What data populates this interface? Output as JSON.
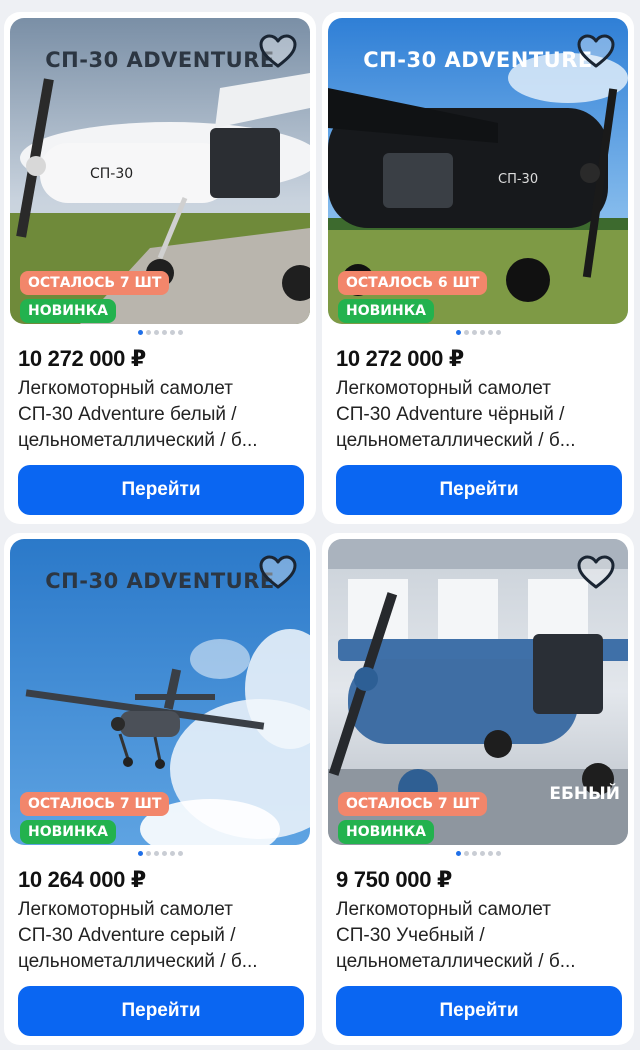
{
  "colors": {
    "accent": "#0a66f2",
    "stock_badge": "#f2866b",
    "new_badge": "#23b24e",
    "dot_active": "#1f6fe8"
  },
  "products": [
    {
      "photo_title": "СП-30 ADVENTURE",
      "photo_subtitle": "",
      "stock_badge": "ОСТАЛОСЬ 7 ШТ",
      "new_badge": "НОВИНКА",
      "price": "10 272 000 ₽",
      "title_lines": [
        "Легкомоторный самолет",
        "СП-30 Adventure белый /",
        "цельнометаллический / б..."
      ],
      "button_label": "Перейти",
      "favorite_icon": "heart-outline-icon"
    },
    {
      "photo_title": "СП-30 ADVENTURE",
      "photo_subtitle": "",
      "stock_badge": "ОСТАЛОСЬ 6 ШТ",
      "new_badge": "НОВИНКА",
      "price": "10 272 000 ₽",
      "title_lines": [
        "Легкомоторный самолет",
        "СП-30 Adventure чёрный /",
        "цельнометаллический / б..."
      ],
      "button_label": "Перейти",
      "favorite_icon": "heart-outline-icon"
    },
    {
      "photo_title": "СП-30 ADVENTURE",
      "photo_subtitle": "",
      "stock_badge": "ОСТАЛОСЬ 7 ШТ",
      "new_badge": "НОВИНКА",
      "price": "10 264 000 ₽",
      "title_lines": [
        "Легкомоторный самолет",
        "СП-30 Adventure серый /",
        "цельнометаллический / б..."
      ],
      "button_label": "Перейти",
      "favorite_icon": "heart-outline-icon"
    },
    {
      "photo_title": "",
      "photo_subtitle": "ЕБНЫЙ",
      "stock_badge": "ОСТАЛОСЬ 7 ШТ",
      "new_badge": "НОВИНКА",
      "price": "9 750 000 ₽",
      "title_lines": [
        "Легкомоторный самолет",
        "СП-30 Учебный /",
        "цельнометаллический / б..."
      ],
      "button_label": "Перейти",
      "favorite_icon": "heart-outline-icon"
    }
  ]
}
